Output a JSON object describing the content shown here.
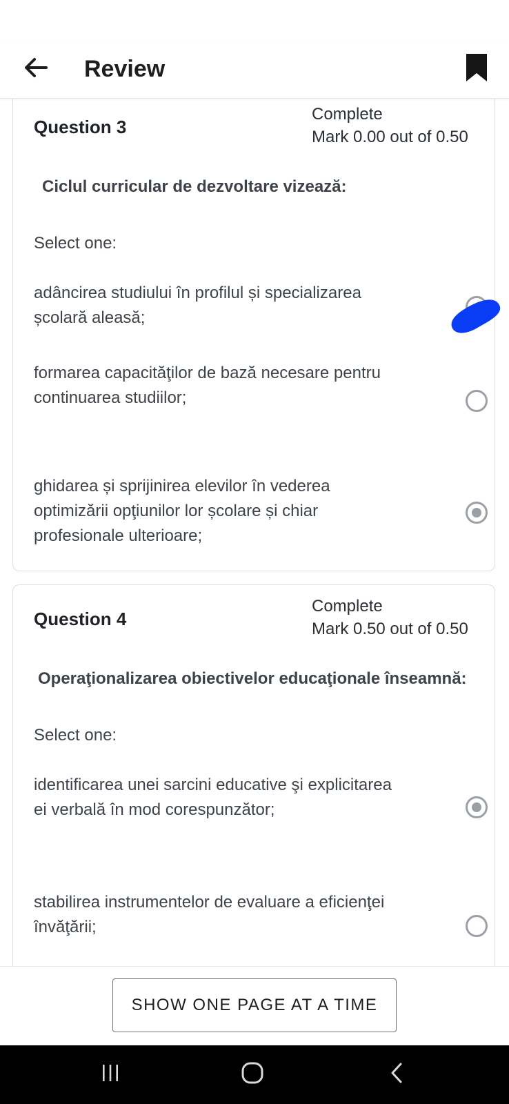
{
  "header": {
    "title": "Review",
    "back_icon": "arrow-left-icon",
    "bookmark_icon": "bookmark-icon"
  },
  "questions": [
    {
      "title": "Question 3",
      "state": "Complete",
      "grade": "Mark 0.00 out of 0.50",
      "text": "Ciclul curricular de dezvoltare vizează:",
      "select_label": "Select one:",
      "options": [
        {
          "label": "adâncirea studiului în profilul și specializarea școlară aleasă;",
          "selected": false
        },
        {
          "label": "formarea capacităţilor de bază necesare pentru continuarea studiilor;",
          "selected": false
        },
        {
          "label": "ghidarea și sprijinirea elevilor în vederea optimizării opţiunilor lor școlare și chiar profesionale ulterioare;",
          "selected": true
        }
      ]
    },
    {
      "title": "Question 4",
      "state": "Complete",
      "grade": "Mark 0.50 out of 0.50",
      "text": "Operaţionalizarea obiectivelor educaţionale înseamnă:",
      "select_label": "Select one:",
      "options": [
        {
          "label": "identificarea unei sarcini educative şi explicitarea ei verbală în mod corespunzător;",
          "selected": true
        },
        {
          "label": "stabilirea instrumentelor de evaluare a eficienţei învăţării;",
          "selected": false
        }
      ]
    }
  ],
  "footer": {
    "button_label": "SHOW ONE PAGE AT A TIME"
  },
  "colors": {
    "scribble": "#0a3cf5",
    "radio_border": "#9aa0a6"
  },
  "system_nav": {
    "recent_icon": "recent-apps-icon",
    "home_icon": "home-icon",
    "back_icon": "back-chevron-icon"
  }
}
